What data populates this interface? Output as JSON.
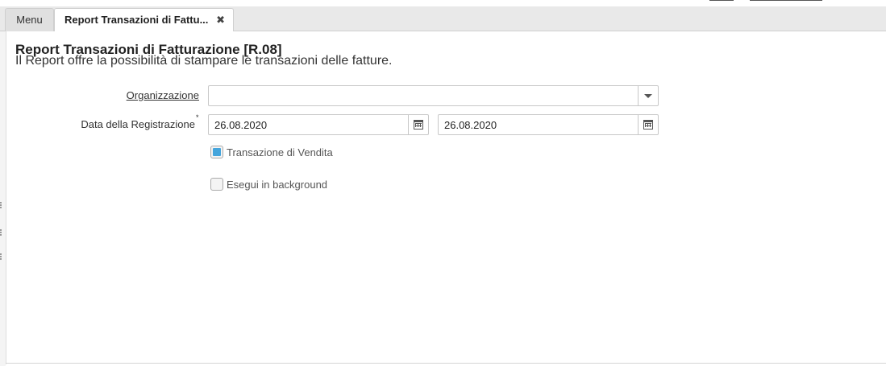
{
  "tabs": {
    "menu_label": "Menu",
    "active_label": "Report Transazioni di Fattu...",
    "close_glyph": "✖"
  },
  "process": {
    "title": "Report Transazioni di Fatturazione [R.08]",
    "description": "Il Report offre la possibilità di stampare le transazioni delle fatture."
  },
  "form": {
    "organization": {
      "label": "Organizzazione",
      "value": "",
      "icon": "chevron-down-icon"
    },
    "registration_date": {
      "label": "Data della Registrazione",
      "mandatory_mark": "*",
      "from": "26.08.2020",
      "to": "26.08.2020",
      "icon": "calendar-icon"
    },
    "sales_transaction": {
      "label": "Transazione di Vendita",
      "checked": true
    },
    "run_in_background": {
      "label": "Esegui in background",
      "checked": false
    }
  },
  "colors": {
    "accent": "#45a5dc",
    "tabbar_bg": "#e9e9e9",
    "border": "#c8c8c8"
  }
}
